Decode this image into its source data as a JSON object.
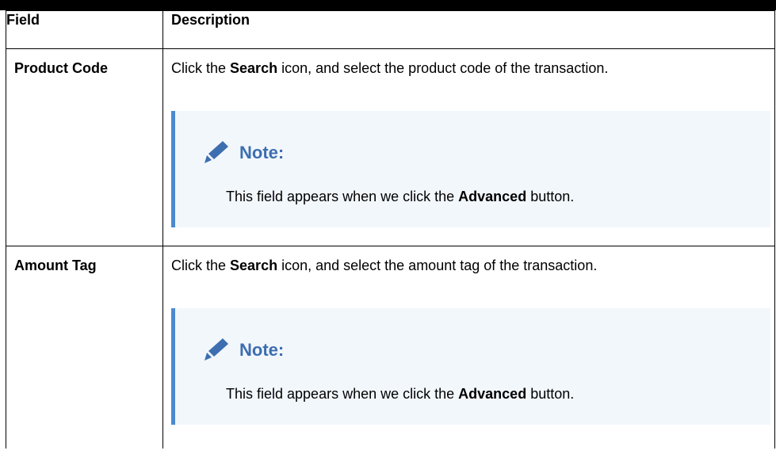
{
  "table": {
    "headers": {
      "field": "Field",
      "description": "Description"
    },
    "rows": [
      {
        "field": "Product Code",
        "desc_prefix": "Click the ",
        "desc_bold": "Search",
        "desc_suffix": " icon, and select the product code of the transaction.",
        "note": {
          "title": "Note:",
          "prefix": "This field appears when we click the ",
          "bold": "Advanced",
          "suffix": " button."
        }
      },
      {
        "field": "Amount Tag",
        "desc_prefix": "Click the ",
        "desc_bold": "Search",
        "desc_suffix": " icon, and select the amount tag of the transaction.",
        "note": {
          "title": "Note:",
          "prefix": "This field appears when we click the ",
          "bold": "Advanced",
          "suffix": " button."
        }
      }
    ]
  },
  "colors": {
    "note_accent": "#4b8ad1",
    "note_background": "#f2f7fc",
    "note_title": "#3d6eaf"
  },
  "icons": {
    "note": "pencil-icon"
  }
}
